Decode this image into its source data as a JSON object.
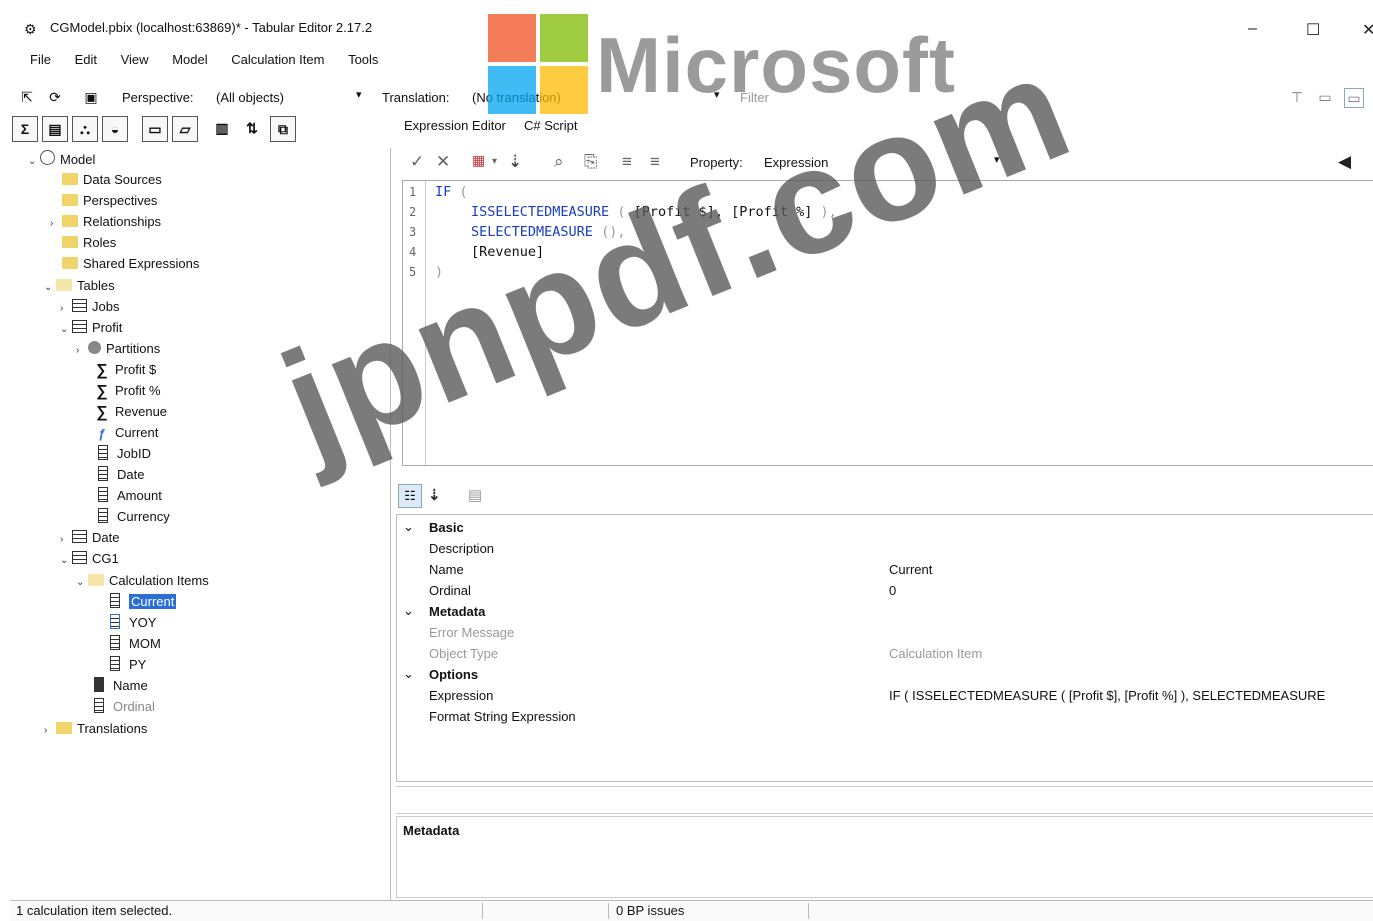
{
  "window": {
    "title": "CGModel.pbix (localhost:63869)* - Tabular Editor 2.17.2",
    "minimize": "–",
    "maximize": "☐",
    "close": "✕"
  },
  "menu": [
    "File",
    "Edit",
    "View",
    "Model",
    "Calculation Item",
    "Tools"
  ],
  "toolbar": {
    "perspective_label": "Perspective:",
    "perspective_value": "(All objects)",
    "translation_label": "Translation:",
    "translation_value": "(No translation)",
    "filter_placeholder": "Filter"
  },
  "tree": {
    "model": "Model",
    "data_sources": "Data Sources",
    "perspectives": "Perspectives",
    "relationships": "Relationships",
    "roles": "Roles",
    "shared_expressions": "Shared Expressions",
    "tables": "Tables",
    "jobs": "Jobs",
    "profit": "Profit",
    "partitions": "Partitions",
    "profit_dollar": "Profit $",
    "profit_pct": "Profit %",
    "revenue": "Revenue",
    "current": "Current",
    "jobid": "JobID",
    "date_col": "Date",
    "amount": "Amount",
    "currency": "Currency",
    "date_table": "Date",
    "cg1": "CG1",
    "calc_items": "Calculation Items",
    "item_current": "Current",
    "item_yoy": "YOY",
    "item_mom": "MOM",
    "item_py": "PY",
    "name": "Name",
    "ordinal": "Ordinal",
    "translations": "Translations"
  },
  "tabs": {
    "expression_editor": "Expression Editor",
    "csharp_script": "C# Script"
  },
  "expression_toolbar": {
    "property_label": "Property:",
    "property_value": "Expression"
  },
  "code": {
    "line_numbers": [
      "1",
      "2",
      "3",
      "4",
      "5"
    ],
    "l1_kw": "IF",
    "l1_p": "(",
    "l2_kw": "ISSELECTEDMEASURE",
    "l2_p1": "(",
    "l2_args": "[Profit $], [Profit %]",
    "l2_p2": "),",
    "l3_kw": "SELECTEDMEASURE",
    "l3_p": "(),",
    "l4": "[Revenue]",
    "l5": ")"
  },
  "properties": {
    "basic": "Basic",
    "description": "Description",
    "name_label": "Name",
    "name_value": "Current",
    "ordinal_label": "Ordinal",
    "ordinal_value": "0",
    "metadata": "Metadata",
    "error_message": "Error Message",
    "object_type_label": "Object Type",
    "object_type_value": "Calculation Item",
    "options": "Options",
    "expression_label": "Expression",
    "expression_value": "IF (  ISSELECTEDMEASURE ( [Profit $], [Profit %] ),  SELECTEDMEASURE",
    "format_string": "Format String Expression"
  },
  "metadata_panel": {
    "title": "Metadata"
  },
  "status": {
    "selection": "1 calculation item selected.",
    "bp": "0 BP issues"
  },
  "watermark": {
    "logo_text": "Microsoft",
    "site": "jpnpdf.com"
  },
  "colors": {
    "selection": "#2b6fd6",
    "keyword": "#1a3ec2",
    "folder": "#f0d46a"
  }
}
